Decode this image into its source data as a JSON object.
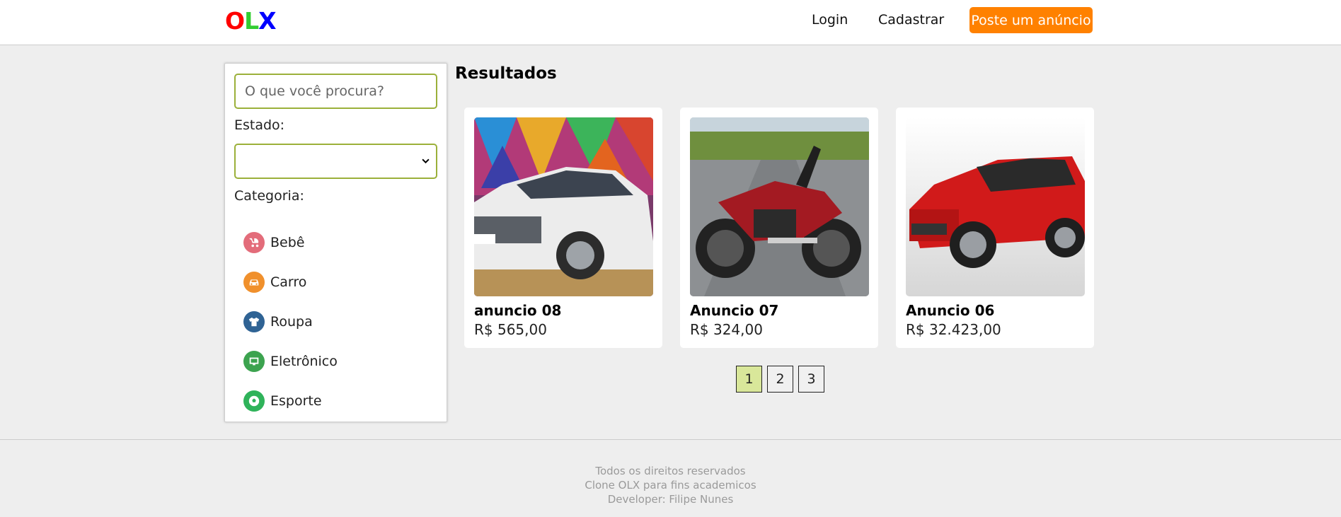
{
  "header": {
    "logo": {
      "o": "O",
      "l": "L",
      "x": "X"
    },
    "login_label": "Login",
    "signup_label": "Cadastrar",
    "post_button_label": "Poste um anúncio"
  },
  "sidebar": {
    "search_placeholder": "O que você procura?",
    "state_label": "Estado:",
    "state_selected": "",
    "category_label": "Categoria:",
    "categories": [
      {
        "label": "Bebê",
        "icon": "baby-stroller-icon",
        "color": "#e36c7a"
      },
      {
        "label": "Carro",
        "icon": "car-icon",
        "color": "#f0902c"
      },
      {
        "label": "Roupa",
        "icon": "shirt-icon",
        "color": "#2f6394"
      },
      {
        "label": "Eletrônico",
        "icon": "monitor-icon",
        "color": "#3ca34f"
      },
      {
        "label": "Esporte",
        "icon": "soccer-ball-icon",
        "color": "#2fb35a"
      }
    ]
  },
  "results": {
    "title": "Resultados",
    "items": [
      {
        "name": "anuncio 08",
        "price": "R$ 565,00"
      },
      {
        "name": "Anuncio 07",
        "price": "R$ 324,00"
      },
      {
        "name": "Anuncio 06",
        "price": "R$ 32.423,00"
      }
    ],
    "pages": [
      "1",
      "2",
      "3"
    ],
    "current_page": "1"
  },
  "footer": {
    "line1": "Todos os direitos reservados",
    "line2": "Clone OLX para fins academicos",
    "line3": "Developer: Filipe Nunes"
  },
  "colors": {
    "accent": "#ff8100",
    "input_border": "#9bb03a",
    "active_page": "#d9e79a"
  }
}
